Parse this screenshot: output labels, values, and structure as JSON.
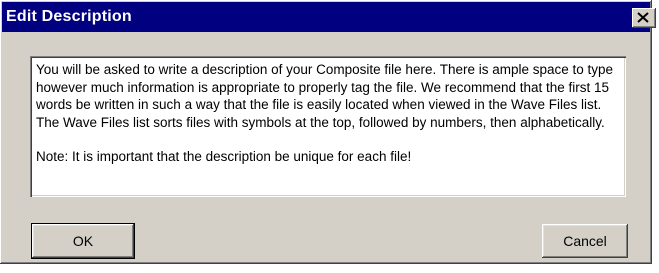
{
  "window": {
    "title": "Edit Description",
    "close_icon": "close-icon"
  },
  "description": {
    "paragraph_1": "You will be asked to write a description of your Composite file here.  There is ample space to type however much information is appropriate to properly tag the file.  We recommend that the first 15 words be written in such a way that the file is easily located when viewed in the Wave Files list.  The Wave Files list sorts files with symbols at the top, followed by numbers, then alphabetically.",
    "paragraph_2": "Note:  It is important that the description be unique for each file!"
  },
  "buttons": {
    "ok_label": "OK",
    "cancel_label": "Cancel"
  },
  "colors": {
    "titlebar": "#000080",
    "dialog_face": "#d4d0c8",
    "text_area": "#ffffff"
  }
}
